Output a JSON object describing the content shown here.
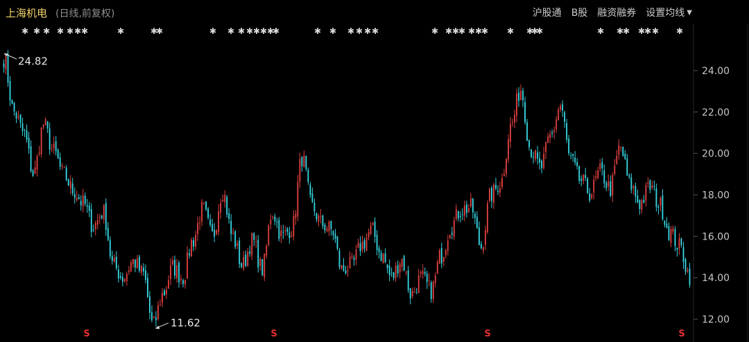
{
  "header": {
    "stock_name": "上海机电",
    "period_label": "(日线,前复权)",
    "menu": [
      "沪股通",
      "B股",
      "融资融券",
      "设置均线"
    ]
  },
  "chart_data": {
    "type": "candlestick",
    "y_ticks": [
      "24.00",
      "22.00",
      "20.00",
      "18.00",
      "16.00",
      "14.00",
      "12.00"
    ],
    "y_tick_values": [
      24,
      22,
      20,
      18,
      16,
      14,
      12
    ],
    "ylim": [
      11.1,
      25.4
    ],
    "annotations": [
      {
        "label": "24.82",
        "value": 24.82,
        "type": "max"
      },
      {
        "label": "11.62",
        "value": 11.62,
        "type": "min"
      }
    ],
    "signal_label": "S",
    "bottom_signal_count": 4,
    "event_marker": "✱",
    "up_color": "#e04040",
    "down_color": "#35d5e0",
    "anchor_closes": [
      24.6,
      22.0,
      21.0,
      19.0,
      21.4,
      20.1,
      19.0,
      18.2,
      17.6,
      16.5,
      17.2,
      14.6,
      14.0,
      14.8,
      14.2,
      11.7,
      13.2,
      14.5,
      14.0,
      15.8,
      17.3,
      16.0,
      18.2,
      16.0,
      14.6,
      15.8,
      14.4,
      17.2,
      16.0,
      16.4,
      19.8,
      17.4,
      16.6,
      16.3,
      14.4,
      14.6,
      15.6,
      16.3,
      15.1,
      14.0,
      14.9,
      13.2,
      14.0,
      13.4,
      15.1,
      16.5,
      17.3,
      17.4,
      15.5,
      18.0,
      18.6,
      21.3,
      23.1,
      20.2,
      19.3,
      20.8,
      22.3,
      19.7,
      18.7,
      18.1,
      19.1,
      18.3,
      20.3,
      18.5,
      17.6,
      18.4,
      17.5,
      16.2,
      15.5,
      14.1
    ]
  }
}
